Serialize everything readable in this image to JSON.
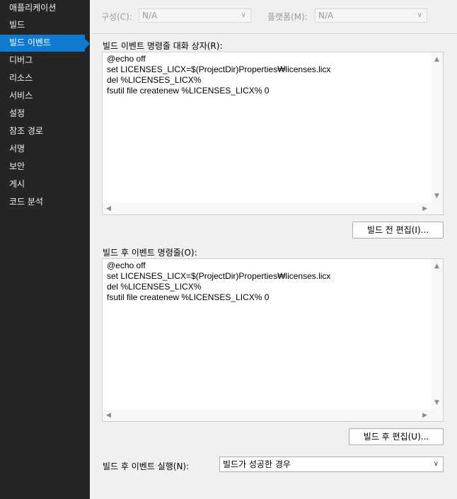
{
  "sidebar": {
    "items": [
      {
        "label": "애플리케이션",
        "active": false
      },
      {
        "label": "빌드",
        "active": false
      },
      {
        "label": "빌드 이벤트",
        "active": true
      },
      {
        "label": "디버그",
        "active": false
      },
      {
        "label": "리소스",
        "active": false
      },
      {
        "label": "서비스",
        "active": false
      },
      {
        "label": "설정",
        "active": false
      },
      {
        "label": "참조 경로",
        "active": false
      },
      {
        "label": "서명",
        "active": false
      },
      {
        "label": "보안",
        "active": false
      },
      {
        "label": "게시",
        "active": false
      },
      {
        "label": "코드 분석",
        "active": false
      }
    ]
  },
  "header": {
    "config_label": "구성(C):",
    "config_value": "N/A",
    "platform_label": "플랫폼(M):",
    "platform_value": "N/A"
  },
  "prebuild": {
    "label": "빌드 이벤트 명령줄 대화 상자(R):",
    "code": "@echo off\nset LICENSES_LICX=$(ProjectDir)Properties₩licenses.licx\ndel %LICENSES_LICX%\nfsutil file createnew %LICENSES_LICX% 0",
    "edit_button": "빌드 전 편집(I)..."
  },
  "postbuild": {
    "label": "빌드 후 이벤트 명령줄(O):",
    "code": "@echo off\nset LICENSES_LICX=$(ProjectDir)Properties₩licenses.licx\ndel %LICENSES_LICX%\nfsutil file createnew %LICENSES_LICX% 0",
    "edit_button": "빌드 후 편집(U)..."
  },
  "run_post": {
    "label": "빌드 후 이벤트 실행(N):",
    "value": "빌드가 성공한 경우"
  },
  "icons": {
    "chevron": "chevron-down-icon",
    "scroll_up": "scroll-up-arrow-icon",
    "scroll_down": "scroll-down-arrow-icon",
    "scroll_left": "scroll-left-arrow-icon",
    "scroll_right": "scroll-right-arrow-icon"
  },
  "colors": {
    "sidebar_bg": "#252526",
    "sidebar_active": "#0e7ad1",
    "panel_bg": "#f0f0f0"
  }
}
